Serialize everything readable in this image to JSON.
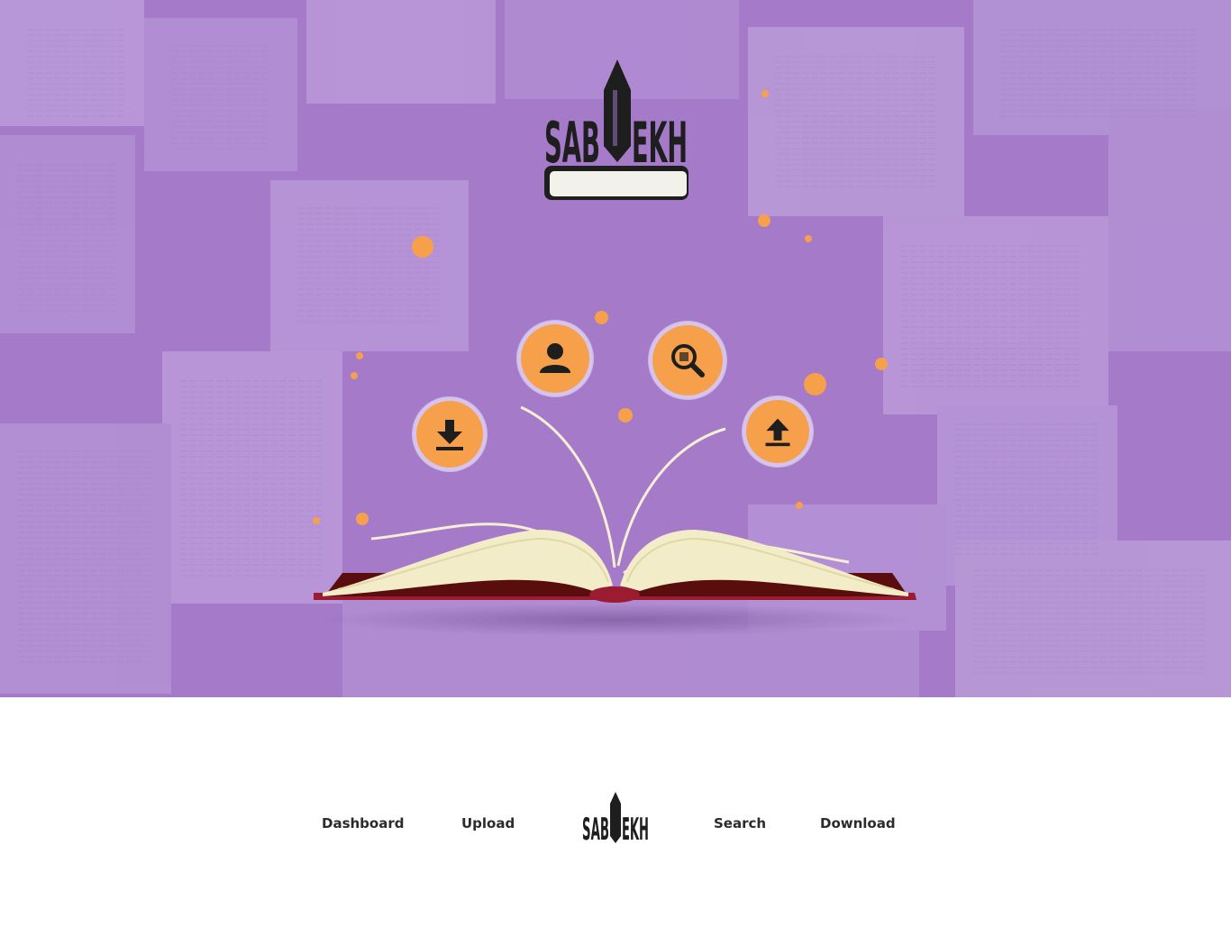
{
  "brand": {
    "logo_text_left": "SAB",
    "logo_text_right": "EKH"
  },
  "hero": {
    "icons": [
      {
        "name": "download-icon",
        "glyph": "download"
      },
      {
        "name": "user-icon",
        "glyph": "user"
      },
      {
        "name": "search-icon",
        "glyph": "search"
      },
      {
        "name": "upload-icon",
        "glyph": "upload"
      }
    ]
  },
  "nav": {
    "dashboard": "Dashboard",
    "upload": "Upload",
    "search": "Search",
    "download": "Download"
  },
  "colors": {
    "hero_background": "#a67dcb",
    "accent_orange": "#f7a04b",
    "book_cover": "#9b1b30",
    "nav_text": "#2b2b2b"
  }
}
